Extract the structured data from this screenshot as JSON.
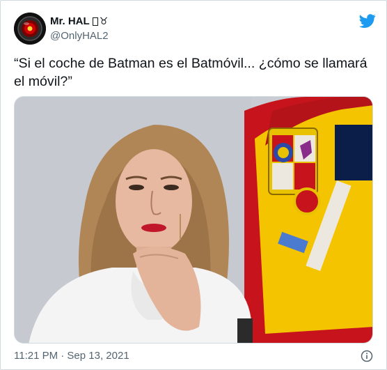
{
  "tweet": {
    "author": {
      "display_name": "Mr. HAL",
      "name_emoji": "♉",
      "handle": "@OnlyHAL2",
      "avatar_icon": "hal9000-eye-icon"
    },
    "text": "“Si el coche de Batman es el Batmóvil... ¿cómo se llamará el móvil?”",
    "media_alt": "photo",
    "timestamp": "11:21 PM · Sep 13, 2021"
  },
  "colors": {
    "brand": "#1d9bf0",
    "text_primary": "#0f1419",
    "text_secondary": "#536471",
    "border": "#cfd9de",
    "flag_red": "#c7141c",
    "flag_yellow": "#f5c400"
  }
}
